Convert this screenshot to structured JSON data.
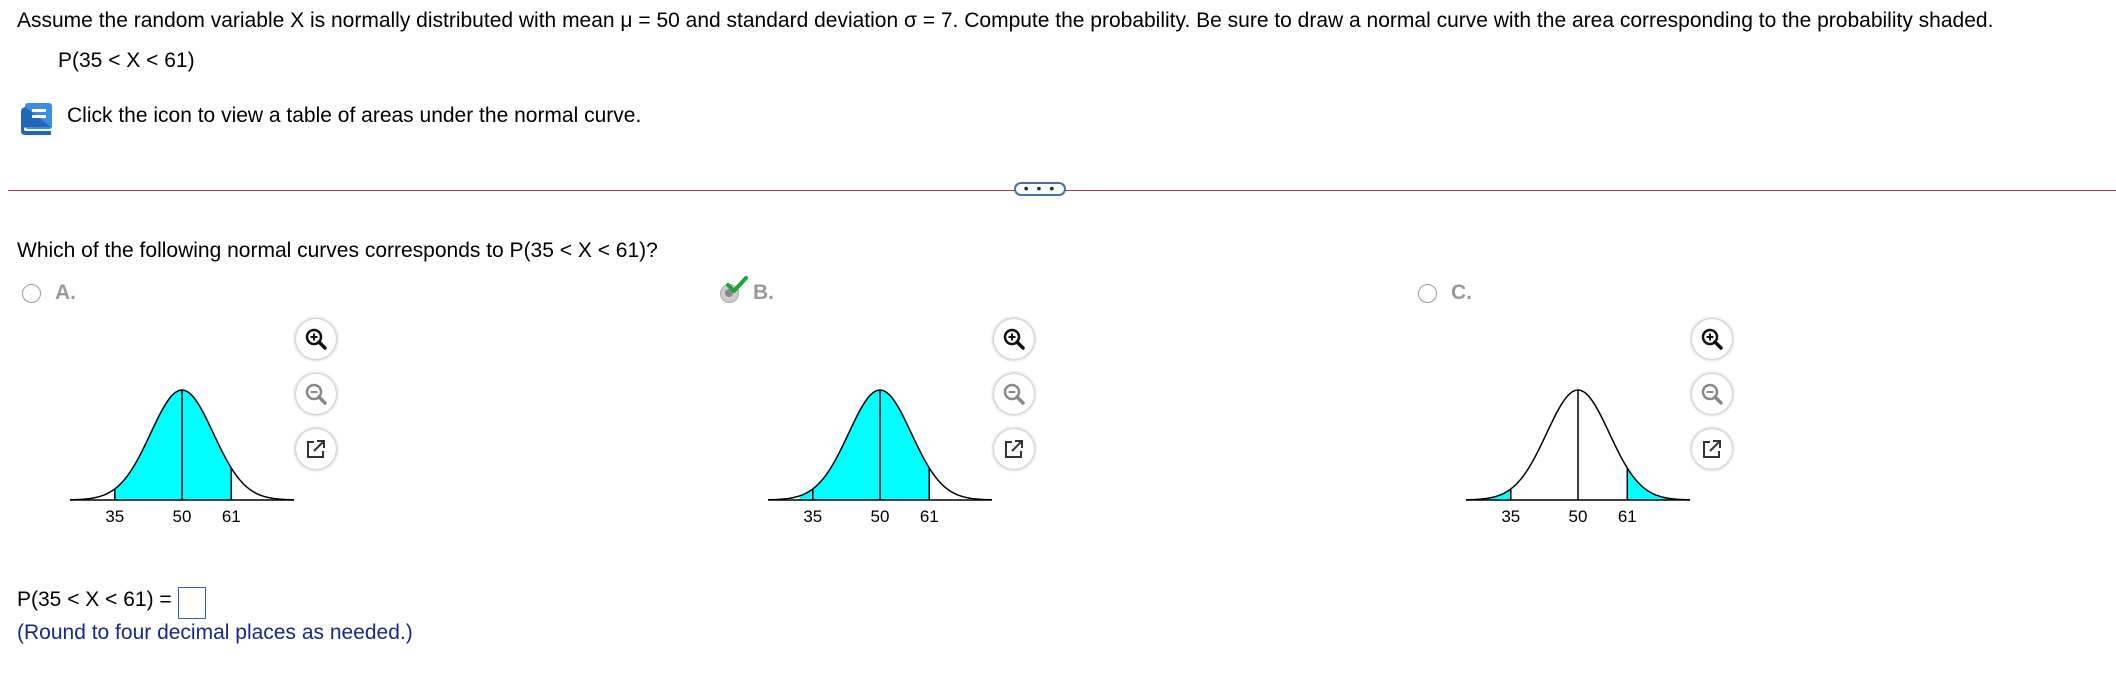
{
  "question": "Assume the random variable X is normally distributed with mean μ = 50 and standard deviation σ = 7. Compute the probability. Be sure to draw a normal curve with the area corresponding to the probability shaded.",
  "probability_expr": "P(35 < X < 61)",
  "hint": "Click the icon to view a table of areas under the normal curve.",
  "more_button": "• • •",
  "sub_question": "Which of the following normal curves corresponds to P(35 < X < 61)?",
  "options": [
    {
      "label": "A.",
      "selected": false,
      "shade": "between",
      "shade_from": 35,
      "shade_to": 61,
      "ticks": [
        "35",
        "50",
        "61"
      ]
    },
    {
      "label": "B.",
      "selected": true,
      "shade": "between",
      "shade_from": 32,
      "shade_to": 61,
      "ticks": [
        "35",
        "50",
        "61"
      ]
    },
    {
      "label": "C.",
      "selected": false,
      "shade": "tails",
      "shade_from": 35,
      "shade_to": 61,
      "ticks": [
        "35",
        "50",
        "61"
      ]
    }
  ],
  "icons": {
    "zoom_in": "zoom-in-icon",
    "zoom_out": "zoom-out-icon",
    "popout": "popout-icon",
    "book": "book-icon",
    "check": "checkmark-icon"
  },
  "colors": {
    "shade": "#00ffff",
    "divider": "#b23a45",
    "link_text": "#142a88",
    "answer_border": "#2f5fd0",
    "check": "#1aa53a"
  },
  "answer": {
    "label": "P(35 < X < 61) =",
    "value": ""
  },
  "round_note": "(Round to four decimal places as needed.)"
}
